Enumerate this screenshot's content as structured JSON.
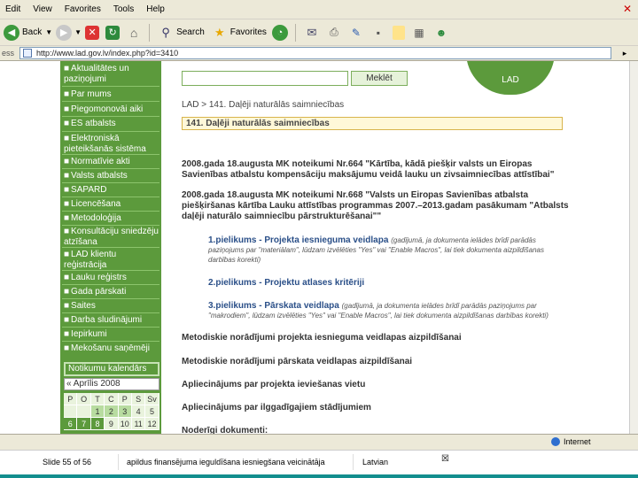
{
  "menu": [
    "Edit",
    "View",
    "Favorites",
    "Tools",
    "Help"
  ],
  "toolbar": {
    "back": "Back",
    "search": "Search",
    "favorites": "Favorites"
  },
  "address": {
    "label": "ess",
    "url": "http://www.lad.gov.lv/index.php?id=3410"
  },
  "nav": [
    "Aktualitātes un paziņojumi",
    "Par mums",
    "Piegomonovāi aiki",
    "ES atbalsts",
    "Elektroniskā pieteikšanās sistēma",
    "Normatīvie akti",
    "Valsts atbalsts",
    "SAPARD",
    "Licencēšana",
    "Metodoloģija",
    "Konsultāciju sniedzēju atzīšana",
    "LAD klientu reģistrācija",
    "Lauku reģistrs",
    "Gada pārskati",
    "Saites",
    "Darba sludinājumi",
    "Iepirkumi",
    "Mekošanu saņēmēji"
  ],
  "calendar": {
    "title": "Notikumu kalendārs",
    "month": "« Aprīlis 2008",
    "days": [
      "P",
      "O",
      "T",
      "C",
      "P",
      "S",
      "Sv"
    ],
    "rows": [
      [
        "",
        "",
        "",
        "",
        "",
        "",
        ""
      ],
      [
        "",
        "",
        "1",
        "2",
        "3",
        "4",
        "5"
      ],
      [
        "6",
        "7",
        "8",
        "9",
        "10",
        "11",
        "12"
      ]
    ]
  },
  "main": {
    "search_button": "Meklēt",
    "logo_text": "LAD",
    "breadcrumb": "LAD > 141. Daļēji naturālās saimniecības",
    "page_title": "141. Daļēji naturālās saimniecības",
    "links": [
      "2008.gada 18.augusta MK noteikumi Nr.664 \"Kārtība, kādā piešķir valsts un Eiropas Savienības atbalstu kompensāciju maksājumu veidā lauku un zivsaimniecības attīstībai\"",
      "2008.gada 18.augusta MK noteikumi Nr.668 \"Valsts un Eiropas Savienības atbalsta piešķiršanas kārtība Lauku attīstības programmas 2007.–2013.gadam pasākumam \"Atbalsts daļēji naturālo saimniecību pārstrukturēšanai\"\""
    ],
    "sub_items": [
      {
        "main": "1.pielikums - Projekta iesnieguma veidlapa",
        "note": "(gadījumā, ja dokumenta ielādes brīdī parādās paziņojums par \"materiālam\", lūdzam izvēlēties \"Yes\" vai \"Enable Macros\", lai tiek dokumenta aizpildīšanas darbības korekti)"
      },
      {
        "main": "2.pielikums - Projektu atlases kritēriji",
        "note": ""
      },
      {
        "main": "3.pielikums - Pārskata veidlapa",
        "note": "(gadījumā, ja dokumenta ielādes brīdī parādās paziņojums par \"makrodiem\", lūdzam izvēlēties \"Yes\" vai \"Enable Macros\", lai tiek dokumenta aizpildīšanas darbības korekti)"
      }
    ],
    "bottom_links": [
      "Metodiskie norādījumi projekta iesnieguma veidlapas aizpildīšanai",
      "Metodiskie norādījumi pārskata veidlapas aizpildīšanai",
      "Apliecinājums par projekta ieviešanas vietu",
      "Apliecinājums par ilggadīgajiem stādījumiem",
      "Noderīgi dokumenti:"
    ]
  },
  "statusbar": {
    "zone": "Internet"
  },
  "ppt": {
    "slide": "Slide 55 of 56",
    "doc": "apildus finansējuma ieguldīšana iesniegšana veicinātāja",
    "lang": "Latvian"
  }
}
